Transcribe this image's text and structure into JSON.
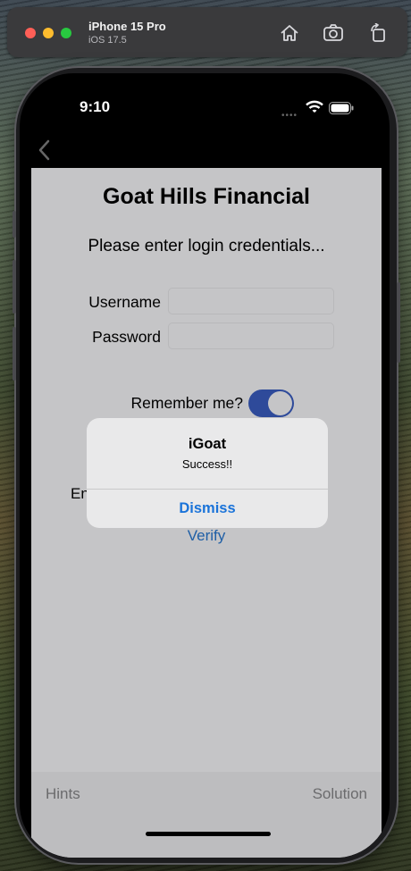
{
  "simulator": {
    "device_name": "iPhone 15 Pro",
    "os_version": "iOS 17.5",
    "toolbar_icons": [
      "home-icon",
      "screenshot-icon",
      "rotate-icon"
    ]
  },
  "status_bar": {
    "time": "9:10",
    "dots": "••••"
  },
  "app": {
    "title": "Goat Hills Financial",
    "subtitle": "Please enter login credentials...",
    "username_label": "Username",
    "username_value": "",
    "password_label": "Password",
    "password_value": "",
    "remember_label": "Remember me?",
    "remember_on": true,
    "partial_label": "En",
    "verify_label": "Verify",
    "hints_label": "Hints",
    "solution_label": "Solution"
  },
  "alert": {
    "title": "iGoat",
    "message": "Success!!",
    "button_label": "Dismiss"
  },
  "colors": {
    "toggle_on": "#2e4a9a",
    "link": "#1f5fa6",
    "alert_button": "#1a73d9"
  }
}
